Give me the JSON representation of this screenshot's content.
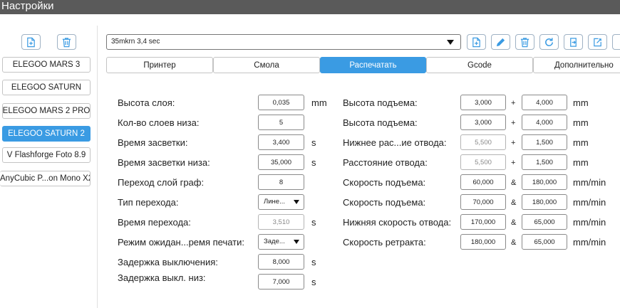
{
  "window": {
    "title": "Настройки"
  },
  "colors": {
    "accent": "#3a9be3",
    "titlebar": "#5a5a5a"
  },
  "sidebar": {
    "add_icon": "file-plus-icon",
    "delete_icon": "trash-icon",
    "printers": [
      {
        "label": "ELEGOO MARS 3",
        "active": false
      },
      {
        "label": "ELEGOO SATURN",
        "active": false
      },
      {
        "label": "ELEGOO MARS 2 PRO",
        "active": false
      },
      {
        "label": "ELEGOO SATURN 2",
        "active": true
      },
      {
        "label": "V Flashforge Foto 8.9",
        "active": false
      },
      {
        "label": "AnyCubic P...on Mono X2",
        "active": false
      }
    ]
  },
  "profile": {
    "selected": "35mkrn 3,4 sec",
    "toolbar_icons": [
      "file-plus-icon",
      "pencil-icon",
      "trash-icon",
      "refresh-icon",
      "import-icon",
      "export-icon"
    ]
  },
  "tabs": [
    {
      "label": "Принтер",
      "active": false
    },
    {
      "label": "Смола",
      "active": false
    },
    {
      "label": "Распечатать",
      "active": true
    },
    {
      "label": "Gcode",
      "active": false
    },
    {
      "label": "Дополнительно",
      "active": false
    }
  ],
  "left_params": [
    {
      "label": "Высота слоя:",
      "value": "0,035",
      "unit": "mm"
    },
    {
      "label": "Кол-во слоев низа:",
      "value": "5",
      "unit": ""
    },
    {
      "label": "Время засветки:",
      "value": "3,400",
      "unit": "s"
    },
    {
      "label": "Время засветки низа:",
      "value": "35,000",
      "unit": "s"
    },
    {
      "label": "Переход слой граф:",
      "value": "8",
      "unit": ""
    },
    {
      "label": "Тип перехода:",
      "value": "Лине...",
      "unit": ""
    },
    {
      "label": "Время перехода:",
      "value": "3,510",
      "unit": "s"
    },
    {
      "label": "Режим ожидан...ремя печати:",
      "value": "Заде...",
      "unit": ""
    },
    {
      "label": "Задержка выключения:",
      "value": "8,000",
      "unit": "s"
    },
    {
      "label": "Задержка выкл. низ:",
      "value": "7,000",
      "unit": "s"
    }
  ],
  "right_params": [
    {
      "label": "Высота подъема:",
      "value1": "3,000",
      "op": "+",
      "value2": "4,000",
      "unit": "mm"
    },
    {
      "label": "Высота подъема:",
      "value1": "3,000",
      "op": "+",
      "value2": "4,000",
      "unit": "mm"
    },
    {
      "label": "Нижнее рас...ие отвода:",
      "value1": "5,500",
      "op": "+",
      "value2": "1,500",
      "unit": "mm"
    },
    {
      "label": "Расстояние отвода:",
      "value1": "5,500",
      "op": "+",
      "value2": "1,500",
      "unit": "mm"
    },
    {
      "label": "Скорость подъема:",
      "value1": "60,000",
      "op": "&",
      "value2": "180,000",
      "unit": "mm/min"
    },
    {
      "label": "Скорость подъема:",
      "value1": "70,000",
      "op": "&",
      "value2": "180,000",
      "unit": "mm/min"
    },
    {
      "label": "Нижняя скорость отвода:",
      "value1": "170,000",
      "op": "&",
      "value2": "65,000",
      "unit": "mm/min"
    },
    {
      "label": "Скорость ретракта:",
      "value1": "180,000",
      "op": "&",
      "value2": "65,000",
      "unit": "mm/min"
    }
  ]
}
